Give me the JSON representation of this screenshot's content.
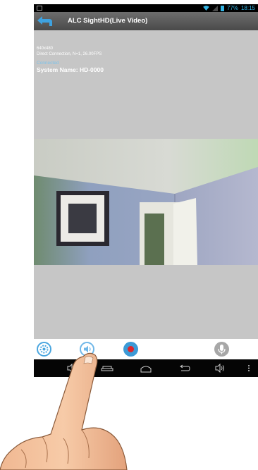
{
  "status_bar": {
    "battery": "77%",
    "time": "18:15"
  },
  "app_bar": {
    "title": "ALC SightHD(Live Video)"
  },
  "stream_info": {
    "resolution": "640x480",
    "connection": "Direct Connection, N=1, 26.00FPS",
    "state": "Connected",
    "system_name": "System Name: HD-0000"
  },
  "toolbar": {
    "buttons": [
      "settings-icon",
      "speaker-icon",
      "record-icon",
      "microphone-icon"
    ]
  },
  "colors": {
    "accent": "#33b5e5",
    "appbar": "#555555",
    "video_background": "#c6c6c6",
    "record_button": "#3c9ad6",
    "record_dot": "#e0242a"
  }
}
